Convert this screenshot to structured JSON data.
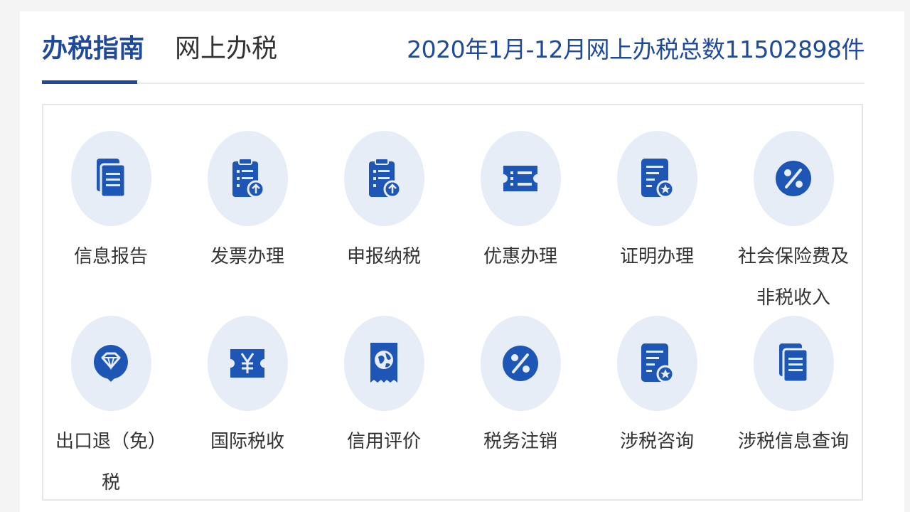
{
  "tabs": [
    {
      "label": "办税指南",
      "active": true
    },
    {
      "label": "网上办税",
      "active": false
    }
  ],
  "summary": "2020年1月-12月网上办税总数11502898件",
  "colors": {
    "accent": "#1f4a9a",
    "icon_blue": "#1d56b5",
    "circle_bg": "#e6edf7"
  },
  "services": [
    {
      "label": "信息报告",
      "icon": "document-stack-icon"
    },
    {
      "label": "发票办理",
      "icon": "clipboard-upload-icon"
    },
    {
      "label": "申报纳税",
      "icon": "clipboard-upload-icon"
    },
    {
      "label": "优惠办理",
      "icon": "ticket-icon"
    },
    {
      "label": "证明办理",
      "icon": "certificate-star-icon"
    },
    {
      "label": "社会保险费及非税收入",
      "icon": "percent-icon"
    },
    {
      "label": "出口退（免）税",
      "icon": "diamond-badge-icon"
    },
    {
      "label": "国际税收",
      "icon": "yen-ticket-icon"
    },
    {
      "label": "信用评价",
      "icon": "globe-receipt-icon"
    },
    {
      "label": "税务注销",
      "icon": "percent-icon"
    },
    {
      "label": "涉税咨询",
      "icon": "certificate-star-icon"
    },
    {
      "label": "涉税信息查询",
      "icon": "document-stack-icon"
    }
  ]
}
